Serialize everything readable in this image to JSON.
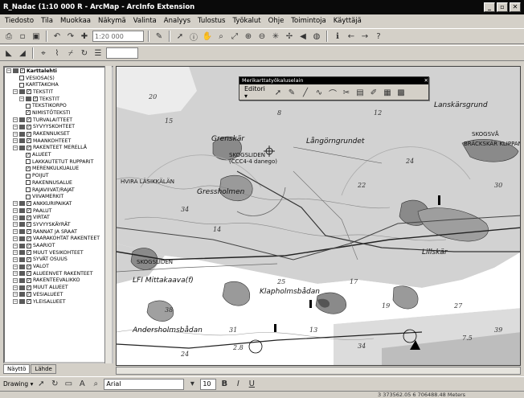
{
  "window": {
    "title": "R_Nadac (1:10 000 R - ArcMap - ArcInfo Extension",
    "buttons": [
      "_",
      "▫",
      "✕"
    ]
  },
  "menu": [
    "Tiedosto",
    "Tila",
    "Muokkaa",
    "Näkymä",
    "Valinta",
    "Analyys",
    "Tulostus",
    "Työkalut",
    "Ohje",
    "Toimintoja",
    "Käyttäjä"
  ],
  "toolbar1": {
    "scale_value": "1:20 000"
  },
  "toolbar2": {
    "layer_value": ""
  },
  "toc": {
    "items": [
      {
        "indent": 0,
        "type": "root",
        "label": "Karttalehti"
      },
      {
        "indent": 1,
        "type": "check",
        "label": "VESIOSA(S)"
      },
      {
        "indent": 1,
        "type": "check",
        "label": "KARTTAKOHA"
      },
      {
        "indent": 1,
        "type": "group",
        "label": "TEKSTIT"
      },
      {
        "indent": 2,
        "type": "group",
        "label": "TEKSTIT"
      },
      {
        "indent": 2,
        "type": "check",
        "label": "TEKSTIKORPO"
      },
      {
        "indent": 2,
        "type": "checked",
        "label": "NIMISTÖTEKSTI"
      },
      {
        "indent": 1,
        "type": "group",
        "label": "TURVALAITTEET"
      },
      {
        "indent": 1,
        "type": "group",
        "label": "SYVYYSKOHTEET"
      },
      {
        "indent": 1,
        "type": "group",
        "label": "RAKENNUKSET"
      },
      {
        "indent": 1,
        "type": "group",
        "label": "MAANKOHTEET"
      },
      {
        "indent": 1,
        "type": "group",
        "label": "RAKENTEET MERELLÄ"
      },
      {
        "indent": 2,
        "type": "checked",
        "label": "ALUEET"
      },
      {
        "indent": 2,
        "type": "check",
        "label": "LAKKAUTETUT RUPPARIT"
      },
      {
        "indent": 2,
        "type": "checked",
        "label": "MERENKULKUALUE"
      },
      {
        "indent": 2,
        "type": "check",
        "label": "POIJUT"
      },
      {
        "indent": 2,
        "type": "check",
        "label": "RAKENNUSALUE"
      },
      {
        "indent": 2,
        "type": "check",
        "label": "RAJAVIIVAT/RAJAT"
      },
      {
        "indent": 2,
        "type": "check",
        "label": "VIIVAMERKIT"
      },
      {
        "indent": 1,
        "type": "group",
        "label": "ANKKURIPAIKAT"
      },
      {
        "indent": 1,
        "type": "group",
        "label": "PAALUT"
      },
      {
        "indent": 1,
        "type": "group",
        "label": "VIRTAT"
      },
      {
        "indent": 1,
        "type": "group",
        "label": "SYVYYSKÄYRÄT"
      },
      {
        "indent": 1,
        "type": "group",
        "label": "RANNAT JA SRAAT"
      },
      {
        "indent": 1,
        "type": "group",
        "label": "VAARAKOHTAT RAKENTEET"
      },
      {
        "indent": 1,
        "type": "group",
        "label": "SAARIOT"
      },
      {
        "indent": 1,
        "type": "group",
        "label": "MUUT VESIKOHTEET"
      },
      {
        "indent": 1,
        "type": "group",
        "label": "SYVÄT OSUUS"
      },
      {
        "indent": 1,
        "type": "group",
        "label": "VALOT"
      },
      {
        "indent": 1,
        "type": "group",
        "label": "ALUEENVET RAKENTEET"
      },
      {
        "indent": 1,
        "type": "group",
        "label": "RAKENTEEVALIKKO"
      },
      {
        "indent": 1,
        "type": "group",
        "label": "MUUT ALUEET"
      },
      {
        "indent": 1,
        "type": "group",
        "label": "VESIALUEET"
      },
      {
        "indent": 1,
        "type": "group",
        "label": "YLEISALUEET"
      }
    ],
    "tabs": [
      "Näyttö",
      "Lähde"
    ]
  },
  "floating_toolbar": {
    "title": "Merikarttatyökaluselain",
    "editor_label": "Editori ▾"
  },
  "map": {
    "labels": [
      {
        "text": "Grenskär",
        "kind": "place"
      },
      {
        "text": "Långörngrundet",
        "kind": "place"
      },
      {
        "text": "SKOGSLIDEN",
        "kind": "caps"
      },
      {
        "text": "(CCC4-4 danego)",
        "kind": "small"
      },
      {
        "text": "Gressholmen",
        "kind": "place"
      },
      {
        "text": "Lanskärsgrund",
        "kind": "place"
      },
      {
        "text": "SKOGSVÅ",
        "kind": "caps"
      },
      {
        "text": "BRÄCKSKÄR KLIPPAN",
        "kind": "caps"
      },
      {
        "text": "HVIRA LÄSIKKÄLÄN",
        "kind": "caps"
      },
      {
        "text": "SKOGSLIDEN",
        "kind": "caps"
      },
      {
        "text": "LFI Mittakaava(f)",
        "kind": "place"
      },
      {
        "text": "Klapholmsbådan",
        "kind": "place"
      },
      {
        "text": "Andersholmsbådan",
        "kind": "place"
      },
      {
        "text": "Lillskär",
        "kind": "place"
      }
    ],
    "depths": [
      "20",
      "32",
      "15",
      "8",
      "12",
      "24",
      "30",
      "22",
      "34",
      "14",
      "25",
      "17",
      "19",
      "38",
      "27",
      "13",
      "2.8",
      "7.5",
      "34",
      "39",
      "24",
      "31"
    ]
  },
  "drawing": {
    "draw_label": "Drawing ▾",
    "font_value": "Arial",
    "size_value": "10"
  },
  "status": {
    "coordinate_text": "3 373562.05 6 706488.48 Meters"
  },
  "colors": {
    "sea": "#ffffff",
    "shallow": "#d2d2d2",
    "land": "#8a8a8a",
    "window_bg": "#d4d0c8",
    "title_bg": "#0a0a0a"
  }
}
